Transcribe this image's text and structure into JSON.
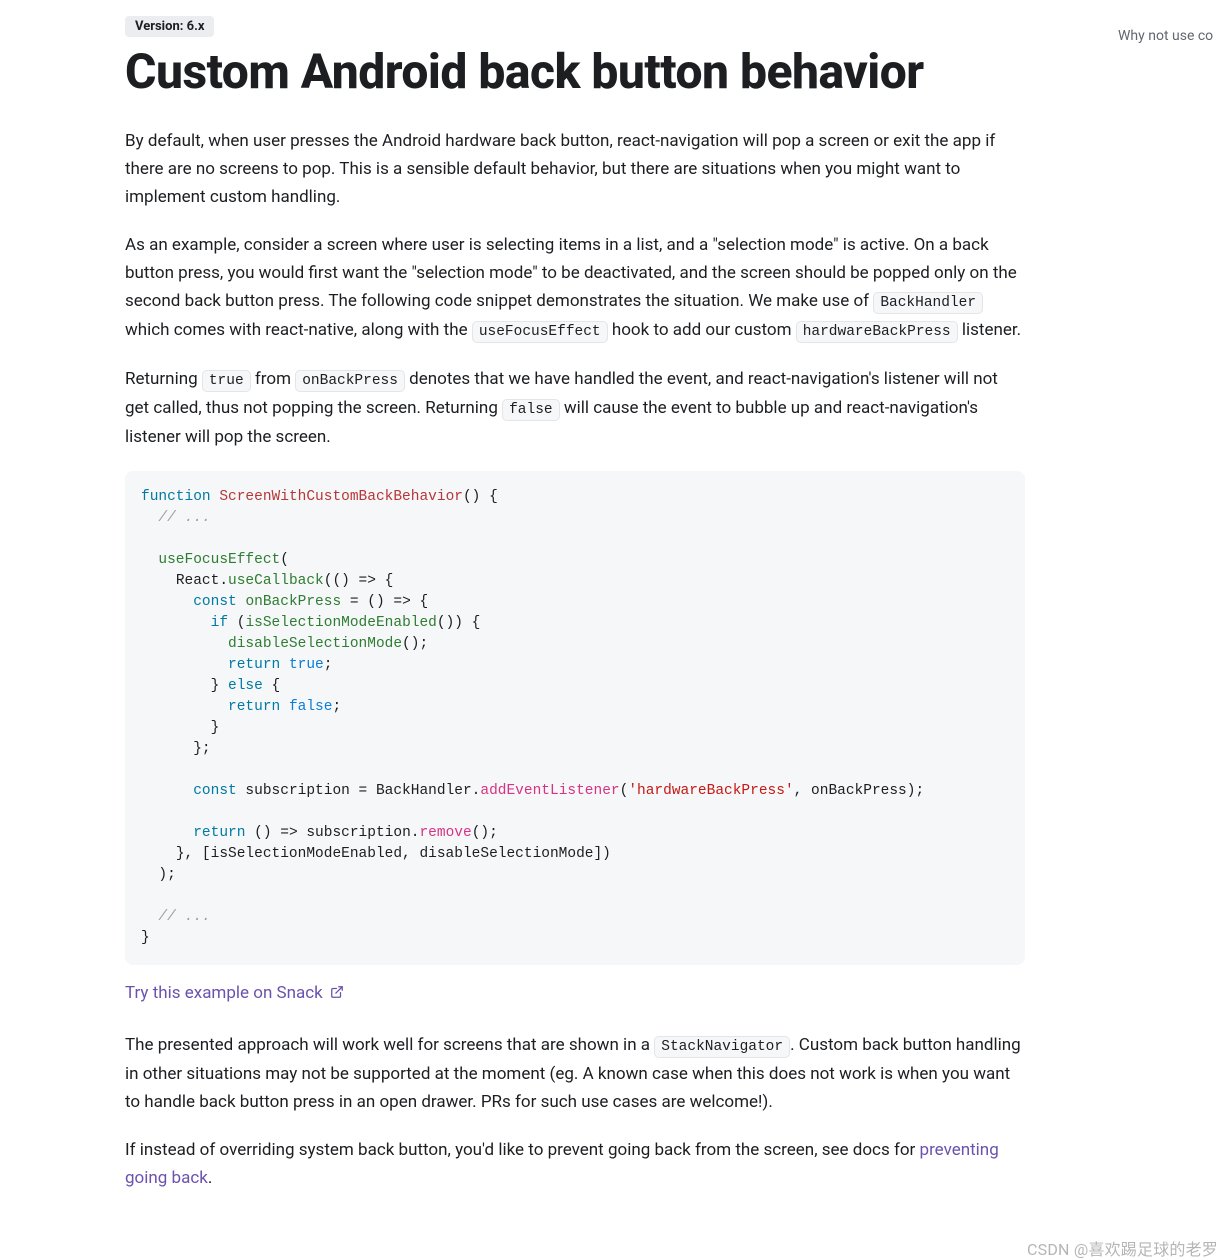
{
  "version_badge": "Version: 6.x",
  "title": "Custom Android back button behavior",
  "sidebar_toc": "Why not use co",
  "paragraphs": {
    "p1": "By default, when user presses the Android hardware back button, react-navigation will pop a screen or exit the app if there are no screens to pop. This is a sensible default behavior, but there are situations when you might want to implement custom handling.",
    "p2_a": "As an example, consider a screen where user is selecting items in a list, and a \"selection mode\" is active. On a back button press, you would first want the \"selection mode\" to be deactivated, and the screen should be popped only on the second back button press. The following code snippet demonstrates the situation. We make use of ",
    "p2_b": " which comes with react-native, along with the ",
    "p2_c": " hook to add our custom ",
    "p2_d": " listener.",
    "p3_a": "Returning ",
    "p3_b": " from ",
    "p3_c": " denotes that we have handled the event, and react-navigation's listener will not get called, thus not popping the screen. Returning ",
    "p3_d": " will cause the event to bubble up and react-navigation's listener will pop the screen.",
    "p4_a": "The presented approach will work well for screens that are shown in a ",
    "p4_b": ". Custom back button handling in other situations may not be supported at the moment (eg. A known case when this does not work is when you want to handle back button press in an open drawer. PRs for such use cases are welcome!).",
    "p5_a": "If instead of overriding system back button, you'd like to prevent going back from the screen, see docs for ",
    "p5_b": "."
  },
  "inline_codes": {
    "BackHandler": "BackHandler",
    "useFocusEffect": "useFocusEffect",
    "hardwareBackPress": "hardwareBackPress",
    "true": "true",
    "onBackPress": "onBackPress",
    "false": "false",
    "StackNavigator": "StackNavigator"
  },
  "snack_link": "Try this example on Snack ",
  "preventing_link": "preventing going back",
  "watermark": "CSDN @喜欢踢足球的老罗",
  "code": {
    "l1_function": "function",
    "l1_name": "ScreenWithCustomBackBehavior",
    "l1_rest": "() {",
    "l2_comment": "// ...",
    "l4_useFocusEffect": "useFocusEffect",
    "l4_rest": "(",
    "l5_react": "React.",
    "l5_useCallback": "useCallback",
    "l5_rest": "(() => {",
    "l6_const": "const",
    "l6_name": "onBackPress",
    "l6_rest": " = () => {",
    "l7_if": "if",
    "l7_open": " (",
    "l7_cond": "isSelectionModeEnabled",
    "l7_rest": "()) {",
    "l8_call": "disableSelectionMode",
    "l8_rest": "();",
    "l9_return": "return",
    "l9_true": "true",
    "l10_else_close": "} ",
    "l10_else": "else",
    "l10_rest": " {",
    "l11_return": "return",
    "l11_false": "false",
    "l12_close": "}",
    "l13_close": "};",
    "l15_const": "const",
    "l15_mid": " subscription = BackHandler.",
    "l15_method": "addEventListener",
    "l15_open": "(",
    "l15_str": "'hardwareBackPress'",
    "l15_rest": ", onBackPress);",
    "l17_return": "return",
    "l17_mid": " () => subscription.",
    "l17_method": "remove",
    "l17_rest": "();",
    "l18": "}, [isSelectionModeEnabled, disableSelectionMode])",
    "l19": ");",
    "l21_comment": "// ...",
    "l22": "}"
  }
}
